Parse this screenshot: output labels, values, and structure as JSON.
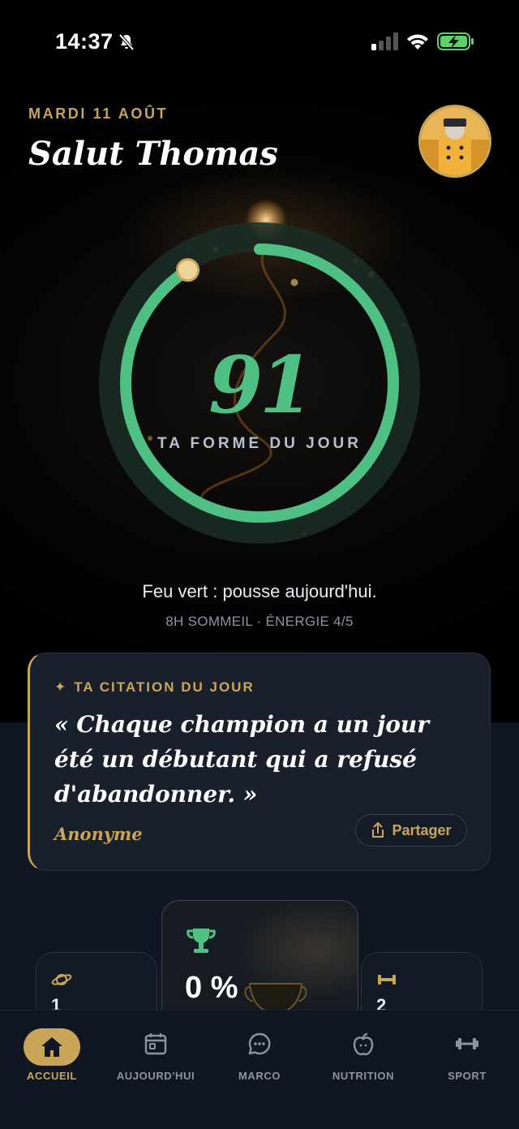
{
  "status_bar": {
    "time": "14:37"
  },
  "header": {
    "date": "MARDI 11 AOÛT",
    "greeting": "Salut Thomas"
  },
  "score": {
    "value": "91",
    "label": "TA FORME DU JOUR",
    "fraction": 0.91
  },
  "summary": {
    "message": "Feu vert : pousse aujourd'hui.",
    "stats": "8H SOMMEIL · ÉNERGIE 4/5"
  },
  "quote": {
    "eyebrow": "TA CITATION DU JOUR",
    "text": "« Chaque champion a un jour été un débutant qui a refusé d'abandonner. »",
    "author": "Anonyme",
    "share_label": "Partager"
  },
  "cards": {
    "left_value": "1",
    "center_value": "0 %",
    "right_value": "2"
  },
  "tabs": [
    {
      "label": "ACCUEIL",
      "icon": "home-icon"
    },
    {
      "label": "AUJOURD'HUI",
      "icon": "calendar-icon"
    },
    {
      "label": "MARCO",
      "icon": "chat-icon"
    },
    {
      "label": "NUTRITION",
      "icon": "apple-icon"
    },
    {
      "label": "SPORT",
      "icon": "dumbbell-icon"
    }
  ],
  "colors": {
    "accent_gold": "#c9a558",
    "ring_green": "#4fbf83",
    "background": "#000000",
    "card": "#19202c"
  }
}
